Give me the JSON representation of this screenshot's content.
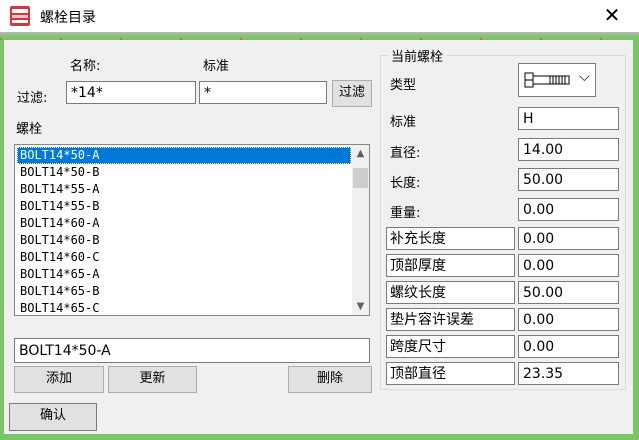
{
  "window": {
    "title": "螺栓目录",
    "close_glyph": "✕",
    "app_icon": "bolt-catalog-icon"
  },
  "filter": {
    "label": "过滤:",
    "name_header": "名称:",
    "standard_header": "标准",
    "name_value": "*14*",
    "standard_value": "*",
    "filter_button": "过滤"
  },
  "bolt_list": {
    "label": "螺栓",
    "items": [
      "BOLT14*50-A",
      "BOLT14*50-B",
      "BOLT14*55-A",
      "BOLT14*55-B",
      "BOLT14*60-A",
      "BOLT14*60-B",
      "BOLT14*60-C",
      "BOLT14*65-A",
      "BOLT14*65-B",
      "BOLT14*65-C"
    ],
    "selected_index": 0
  },
  "name_edit": {
    "value": "BOLT14*50-A"
  },
  "actions": {
    "add": "添加",
    "update": "更新",
    "delete": "删除",
    "confirm": "确认"
  },
  "current_bolt": {
    "group_title": "当前螺栓",
    "type_label": "类型",
    "type_icon": "bolt-type-icon",
    "standard_label": "标准",
    "standard_value": "H",
    "diameter_label": "直径:",
    "diameter_value": "14.00",
    "length_label": "长度:",
    "length_value": "50.00",
    "weight_label": "重量:",
    "weight_value": "0.00",
    "extra_length_label": "补充长度",
    "extra_length_value": "0.00",
    "top_thickness_label": "顶部厚度",
    "top_thickness_value": "0.00",
    "thread_length_label": "螺纹长度",
    "thread_length_value": "50.00",
    "washer_tolerance_label": "垫片容许误差",
    "washer_tolerance_value": "0.00",
    "span_size_label": "跨度尺寸",
    "span_size_value": "0.00",
    "top_diameter_label": "顶部直径",
    "top_diameter_value": "23.35"
  },
  "colors": {
    "selection": "#0078d7",
    "frame_green": "#7cc36c"
  }
}
